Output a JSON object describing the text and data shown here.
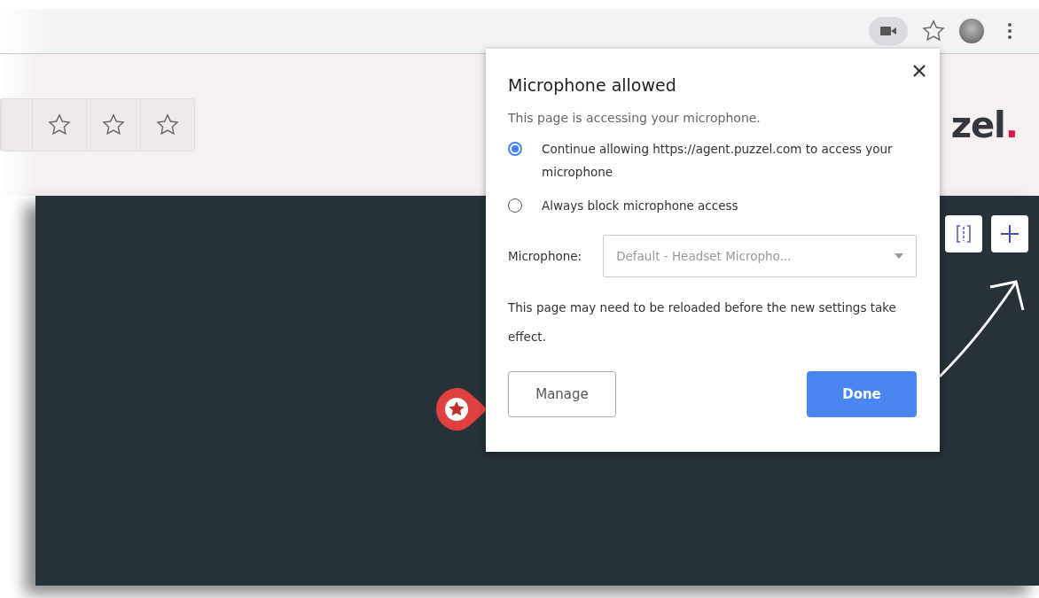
{
  "toolbar": {
    "camera_active": true
  },
  "page": {
    "rating": {
      "stars": 0
    },
    "logo": {
      "text": "zel",
      "dot": "."
    }
  },
  "popup": {
    "title": "Microphone allowed",
    "subtitle": "This page is accessing your microphone.",
    "options": [
      {
        "label": "Continue allowing https://agent.puzzel.com to access your microphone",
        "selected": true
      },
      {
        "label": "Always block microphone access",
        "selected": false
      }
    ],
    "microphone": {
      "label": "Microphone:",
      "value": "Default - Headset Micropho..."
    },
    "note": "This page may need to be reloaded before the new settings take effect.",
    "buttons": [
      {
        "label": "Manage",
        "kind": "secondary"
      },
      {
        "label": "Done",
        "kind": "primary"
      }
    ]
  }
}
